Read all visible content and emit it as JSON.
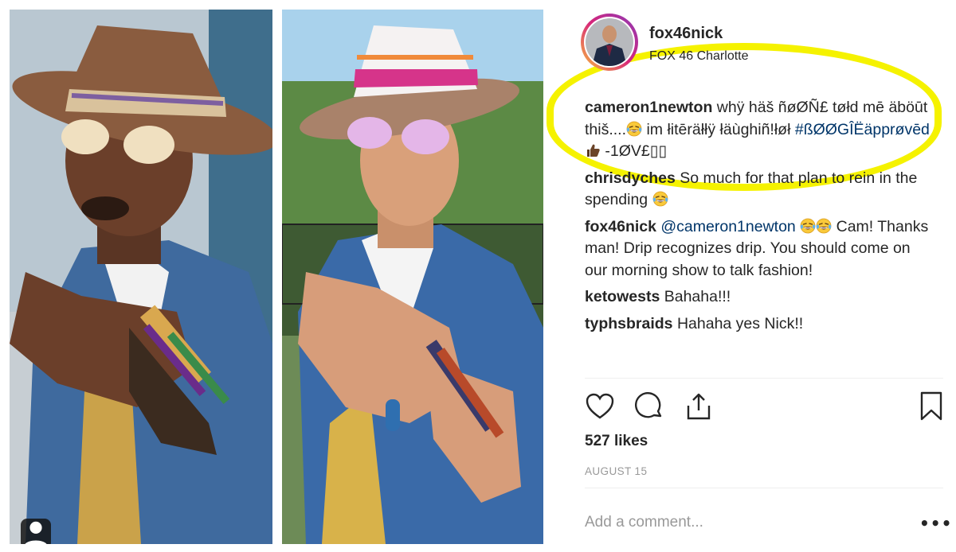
{
  "post": {
    "username": "fox46nick",
    "location": "FOX 46 Charlotte"
  },
  "comments": [
    {
      "user": "cameron1newton",
      "parts": [
        {
          "t": "text",
          "v": " whÿ häš ñøØÑ£ tøłd mē äböūt thiš...."
        },
        {
          "t": "emoji",
          "v": "laugh-cry"
        },
        {
          "t": "text",
          "v": " im łitēräłłÿ łäùghiñ!łøł "
        },
        {
          "t": "link",
          "v": "#ßØØGÎËäpprøvēd"
        },
        {
          "t": "emoji",
          "v": "thumbs-up"
        },
        {
          "t": "text",
          "v": " -1ØV£▯▯"
        }
      ]
    },
    {
      "user": "chrisdyches",
      "parts": [
        {
          "t": "text",
          "v": " So much for that plan to rein in the spending "
        },
        {
          "t": "emoji",
          "v": "laugh-cry"
        }
      ]
    },
    {
      "user": "fox46nick",
      "parts": [
        {
          "t": "text",
          "v": " "
        },
        {
          "t": "link",
          "v": "@cameron1newton"
        },
        {
          "t": "text",
          "v": " "
        },
        {
          "t": "emoji",
          "v": "laugh-cry"
        },
        {
          "t": "emoji",
          "v": "laugh-cry"
        },
        {
          "t": "text",
          "v": " Cam! Thanks man! Drip recognizes drip. You should come on our morning show to talk fashion!"
        }
      ]
    },
    {
      "user": "ketowests",
      "parts": [
        {
          "t": "text",
          "v": " Bahaha!!!"
        }
      ]
    },
    {
      "user": "typhsbraids",
      "parts": [
        {
          "t": "text",
          "v": " Hahaha yes Nick!!"
        }
      ]
    }
  ],
  "actions": {
    "like_icon": "heart-icon",
    "comment_icon": "comment-bubble-icon",
    "share_icon": "share-upload-icon",
    "save_icon": "bookmark-icon"
  },
  "likes": "527 likes",
  "date": "AUGUST 15",
  "comment_input": {
    "placeholder": "Add a comment..."
  },
  "more_label": "•••",
  "colors": {
    "highlight": "#f5f200",
    "text": "#262626",
    "link": "#003569",
    "muted": "#999999",
    "avatar_ring": [
      "#f8c03c",
      "#d7267a",
      "#8a3ab9"
    ]
  }
}
